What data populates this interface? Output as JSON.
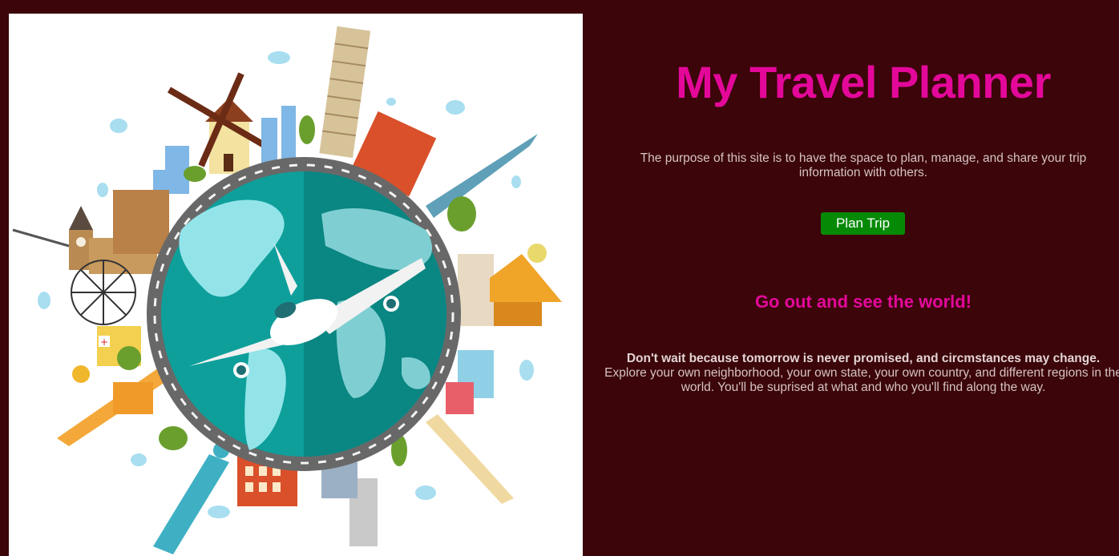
{
  "header": {
    "title": "My Travel Planner"
  },
  "intro": {
    "purpose": "The purpose of this site is to have the space to plan, manage, and share your trip information with others."
  },
  "actions": {
    "plan_trip_label": "Plan Trip"
  },
  "section": {
    "heading": "Go out and see the world!",
    "bold_text": "Don't wait because tomorrow is never promised, and circmstances may change.",
    "body_text": "Explore your own neighborhood, your own state, your own country, and different regions in the world. You'll be suprised at what and who you'll find along the way."
  },
  "colors": {
    "background": "#3b0509",
    "accent": "#e4089a",
    "button": "#068a06",
    "text": "#d6c3c4"
  },
  "illustration": {
    "icon": "globe-with-landmarks-and-airplane"
  }
}
